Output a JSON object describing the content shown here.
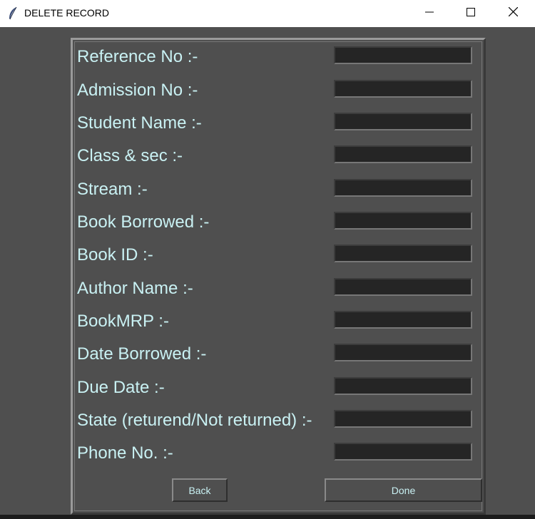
{
  "window": {
    "title": "DELETE RECORD",
    "icon": "feather-icon",
    "controls": [
      "minimize-icon",
      "maximize-icon",
      "close-icon"
    ]
  },
  "colors": {
    "background": "#4f4f4f",
    "label_text": "#c9f1f3",
    "input_background": "#252525"
  },
  "form": {
    "fields": [
      {
        "label": "Reference No :-",
        "value": ""
      },
      {
        "label": "Admission No :-",
        "value": ""
      },
      {
        "label": "Student Name :-",
        "value": ""
      },
      {
        "label": "Class & sec :-",
        "value": ""
      },
      {
        "label": "Stream :-",
        "value": ""
      },
      {
        "label": "Book Borrowed :-",
        "value": ""
      },
      {
        "label": "Book ID :-",
        "value": ""
      },
      {
        "label": "Author Name :-",
        "value": ""
      },
      {
        "label": "BookMRP :-",
        "value": ""
      },
      {
        "label": "Date Borrowed :-",
        "value": ""
      },
      {
        "label": "Due Date :-",
        "value": ""
      },
      {
        "label": "State (returend/Not returned) :-",
        "value": ""
      },
      {
        "label": "Phone No. :-",
        "value": ""
      }
    ]
  },
  "buttons": {
    "back": "Back",
    "done": "Done"
  }
}
